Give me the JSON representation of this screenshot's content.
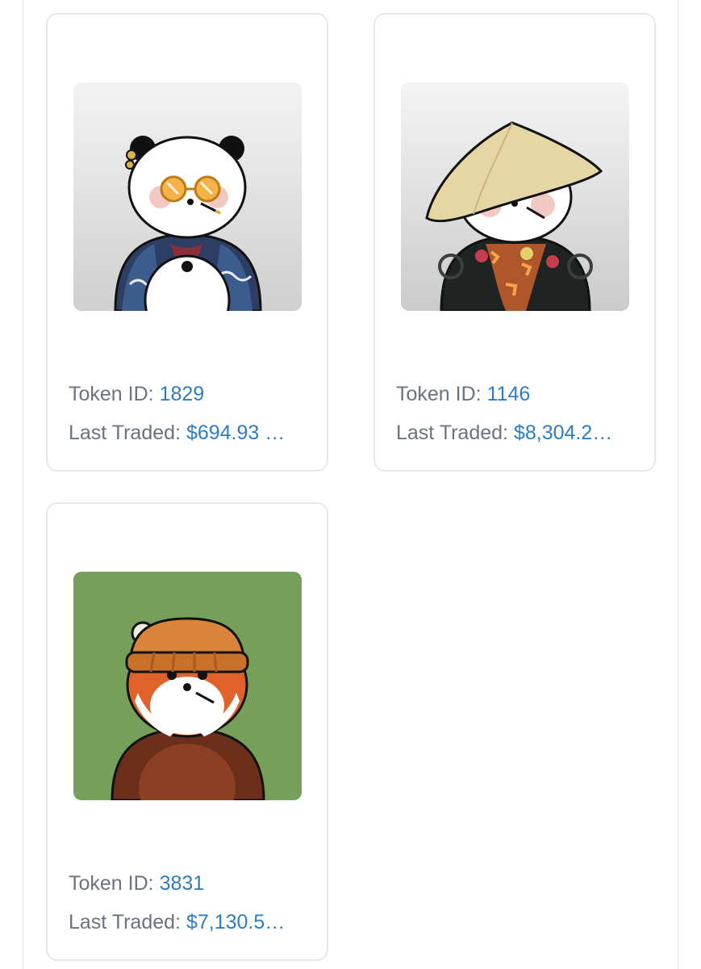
{
  "cards": [
    {
      "token_label": "Token ID: ",
      "token_id": "1829",
      "traded_label": "Last Traded: ",
      "traded_value": "$694.93 …",
      "image": "panda-with-orange-sunglasses-and-wave-jacket",
      "bg_color": "#d9d9d9"
    },
    {
      "token_label": "Token ID: ",
      "token_id": "1146",
      "traded_label": "Last Traded: ",
      "traded_value": "$8,304.2…",
      "image": "panda-with-straw-hat-and-tiger-jacket",
      "bg_color": "#dcdcdc"
    },
    {
      "token_label": "Token ID: ",
      "token_id": "3831",
      "traded_label": "Last Traded: ",
      "traded_value": "$7,130.5…",
      "image": "red-panda-with-beanie",
      "bg_color": "#76a05a"
    }
  ],
  "colors": {
    "label_text": "#6b7280",
    "value_text": "#2f7cc0",
    "card_border": "#e6e8eb"
  }
}
